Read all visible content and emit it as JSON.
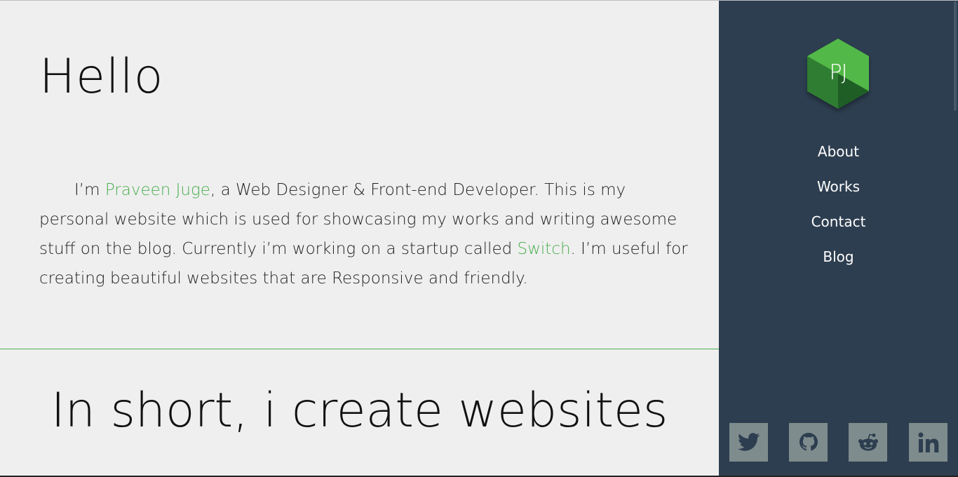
{
  "hero": {
    "title": "Hello",
    "intro_before": "I’m ",
    "name_link": "Praveen Juge",
    "intro_middle": ", a Web Designer & Front-end Developer. This is my personal website which is used for showcasing my works and writing awesome stuff on the blog. Currently i’m working on a startup called ",
    "startup_link": "Switch",
    "intro_after": ". I’m useful for creating beautiful websites that are Responsive and friendly."
  },
  "section": {
    "tagline": "In short, i create websites"
  },
  "sidebar": {
    "logo_text": "PJ",
    "nav": [
      {
        "label": "About"
      },
      {
        "label": "Works"
      },
      {
        "label": "Contact"
      },
      {
        "label": "Blog"
      }
    ],
    "social": [
      {
        "icon": "twitter-icon"
      },
      {
        "icon": "github-icon"
      },
      {
        "icon": "reddit-icon"
      },
      {
        "icon": "linkedin-icon"
      }
    ]
  },
  "colors": {
    "accent": "#4caf50",
    "sidebar_bg": "#2d3e50",
    "page_bg": "#efefef",
    "social_bg": "#7f8c8d",
    "social_icon": "#2d3e50"
  }
}
